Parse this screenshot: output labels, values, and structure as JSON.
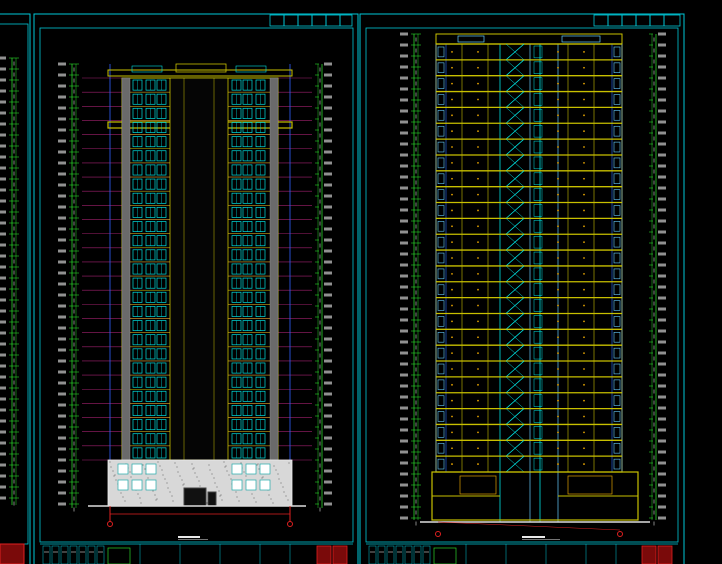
{
  "colors": {
    "background": "#000000",
    "frame": "#00c8d8",
    "dimension": "#2bd52b",
    "level_line": "#a0206e",
    "facade": "#c8c000",
    "glazing": "#00e0e0",
    "title_block_red": "#e02020"
  },
  "drawing": {
    "sheets": [
      {
        "name": "elevation-sheet"
      },
      {
        "name": "section-sheet"
      }
    ],
    "floors": 27,
    "elevation_caption": "",
    "section_caption": ""
  }
}
